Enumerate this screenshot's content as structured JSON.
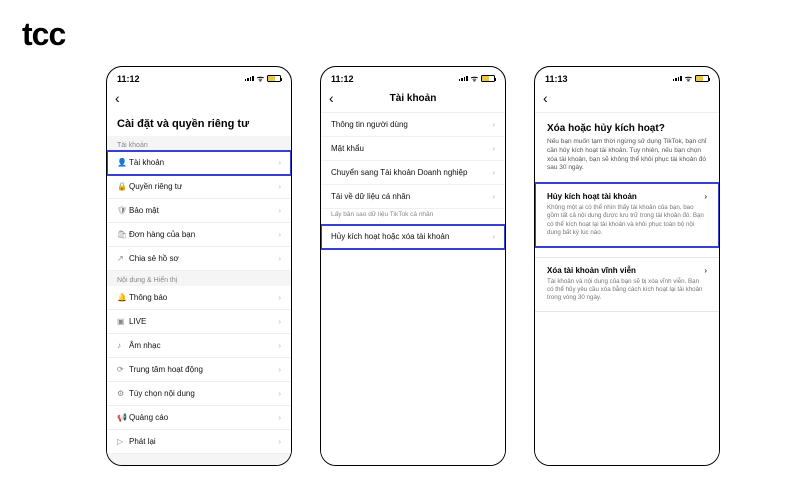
{
  "logo": "tcc",
  "phones": [
    {
      "time": "11:12",
      "title": "Cài đặt và quyền riêng tư",
      "centerTitle": false,
      "sections": [
        {
          "header": "Tài khoản",
          "rows": [
            {
              "icon": "👤",
              "label": "Tài khoản",
              "hl": true,
              "name": "row-account"
            },
            {
              "icon": "🔒",
              "label": "Quyền riêng tư",
              "name": "row-privacy"
            },
            {
              "icon": "🛡",
              "label": "Bảo mật",
              "name": "row-security"
            },
            {
              "icon": "🛍",
              "label": "Đơn hàng của bạn",
              "name": "row-orders"
            },
            {
              "icon": "↗",
              "label": "Chia sẻ hồ sơ",
              "name": "row-share-profile"
            }
          ]
        },
        {
          "header": "Nội dung & Hiển thị",
          "rows": [
            {
              "icon": "🔔",
              "label": "Thông báo",
              "name": "row-notifications"
            },
            {
              "icon": "▣",
              "label": "LIVE",
              "name": "row-live"
            },
            {
              "icon": "♪",
              "label": "Âm nhạc",
              "name": "row-music"
            },
            {
              "icon": "⟳",
              "label": "Trung tâm hoạt động",
              "name": "row-activity"
            },
            {
              "icon": "⚙",
              "label": "Tùy chọn nội dung",
              "name": "row-content-pref"
            },
            {
              "icon": "📢",
              "label": "Quảng cáo",
              "name": "row-ads"
            },
            {
              "icon": "▷",
              "label": "Phát lại",
              "name": "row-playback"
            }
          ]
        }
      ]
    },
    {
      "time": "11:12",
      "title": "Tài khoản",
      "centerTitle": true,
      "rows": [
        {
          "label": "Thông tin người dùng",
          "name": "row-user-info"
        },
        {
          "label": "Mật khẩu",
          "name": "row-password"
        },
        {
          "label": "Chuyển sang Tài khoản Doanh nghiệp",
          "name": "row-switch-business"
        },
        {
          "label": "Tải về dữ liệu cá nhân",
          "sub": "Lấy bản sao dữ liệu TikTok cá nhân",
          "name": "row-download-data"
        },
        {
          "label": "Hủy kích hoạt hoặc xóa tài khoản",
          "hl": true,
          "name": "row-deactivate-delete"
        }
      ]
    },
    {
      "time": "11:13",
      "title": "",
      "centerTitle": true,
      "s3_title": "Xóa hoặc hủy kích hoạt?",
      "s3_intro": "Nếu bạn muốn tạm thời ngừng sử dụng TikTok, bạn chỉ cần hủy kích hoạt tài khoản. Tuy nhiên, nếu bạn chọn xóa tài khoản, bạn sẽ không thể khôi phục tài khoản đó sau 30 ngày.",
      "cards": [
        {
          "title": "Hủy kích hoạt tài khoản",
          "desc": "Không một ai có thể nhìn thấy tài khoản của bạn, bao gồm tất cả nội dung được lưu trữ trong tài khoản đó. Bạn có thể kích hoạt lại tài khoản và khôi phục toàn bộ nội dung bất kỳ lúc nào.",
          "hl": true,
          "name": "card-deactivate"
        },
        {
          "title": "Xóa tài khoản vĩnh viễn",
          "desc": "Tài khoản và nội dung của bạn sẽ bị xóa vĩnh viễn. Bạn có thể hủy yêu cầu xóa bằng cách kích hoạt lại tài khoản trong vòng 30 ngày.",
          "name": "card-delete"
        }
      ]
    }
  ]
}
